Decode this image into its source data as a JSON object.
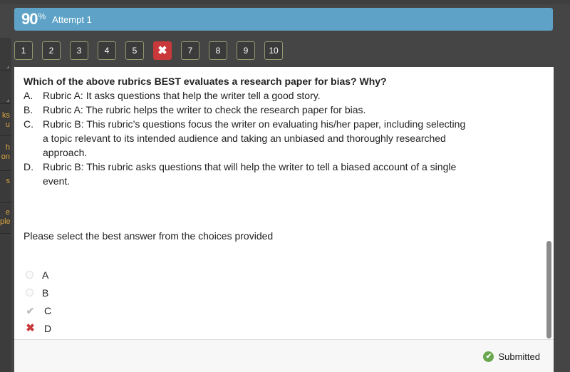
{
  "header": {
    "score": "90",
    "score_unit": "%",
    "attempt": "Attempt 1",
    "accent_color": "#5ea3c7"
  },
  "sidebar": {
    "items": [
      {
        "label": ""
      },
      {
        "label": ""
      },
      {
        "label": "ks\nu"
      },
      {
        "label": "h\non"
      },
      {
        "label": "s"
      },
      {
        "label": "e\nple"
      }
    ]
  },
  "question_nav": {
    "items": [
      {
        "label": "1",
        "status": "default"
      },
      {
        "label": "2",
        "status": "default"
      },
      {
        "label": "3",
        "status": "default"
      },
      {
        "label": "4",
        "status": "default"
      },
      {
        "label": "5",
        "status": "default"
      },
      {
        "label": "✖",
        "status": "incorrect",
        "icon": "x-icon"
      },
      {
        "label": "7",
        "status": "default"
      },
      {
        "label": "8",
        "status": "default"
      },
      {
        "label": "9",
        "status": "default"
      },
      {
        "label": "10",
        "status": "default"
      }
    ]
  },
  "question": {
    "title": "Which of the above rubrics BEST evaluates a research paper for bias? Why?",
    "choices": [
      {
        "letter": "A.",
        "text": "Rubric A: It asks questions that help the writer tell a good story."
      },
      {
        "letter": "B.",
        "text": "Rubric A: The rubric helps the writer to check the research paper for bias."
      },
      {
        "letter": "C.",
        "text": "Rubric B: This rubric’s questions focus the writer on evaluating his/her paper, including selecting a topic relevant to its intended audience and taking an unbiased and thoroughly researched approach."
      },
      {
        "letter": "D.",
        "text": "Rubric B: This rubric asks questions that will help the writer to tell a biased account of a single event."
      }
    ],
    "instruction": "Please select the best answer from the choices provided"
  },
  "answers": [
    {
      "label": "A",
      "state": "unselected",
      "icon": "radio-icon"
    },
    {
      "label": "B",
      "state": "unselected",
      "icon": "radio-icon"
    },
    {
      "label": "C",
      "state": "correct-answer",
      "icon": "check-icon",
      "glyph": "✔"
    },
    {
      "label": "D",
      "state": "selected-incorrect",
      "icon": "x-icon",
      "glyph": "✖"
    }
  ],
  "footer": {
    "status": "Submitted",
    "status_glyph": "✔",
    "status_color": "#6aa84f"
  }
}
